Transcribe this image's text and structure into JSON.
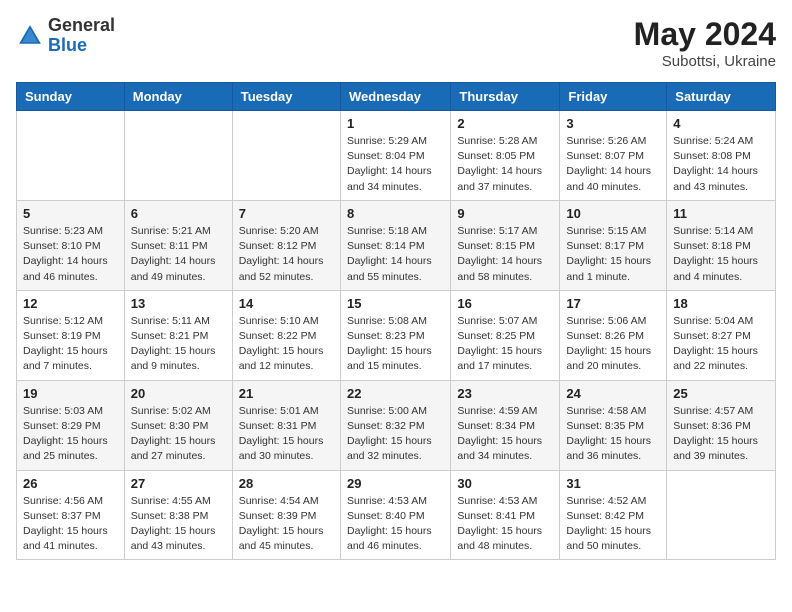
{
  "header": {
    "logo_general": "General",
    "logo_blue": "Blue",
    "month": "May 2024",
    "location": "Subottsi, Ukraine"
  },
  "weekdays": [
    "Sunday",
    "Monday",
    "Tuesday",
    "Wednesday",
    "Thursday",
    "Friday",
    "Saturday"
  ],
  "weeks": [
    [
      {
        "day": "",
        "info": ""
      },
      {
        "day": "",
        "info": ""
      },
      {
        "day": "",
        "info": ""
      },
      {
        "day": "1",
        "info": "Sunrise: 5:29 AM\nSunset: 8:04 PM\nDaylight: 14 hours\nand 34 minutes."
      },
      {
        "day": "2",
        "info": "Sunrise: 5:28 AM\nSunset: 8:05 PM\nDaylight: 14 hours\nand 37 minutes."
      },
      {
        "day": "3",
        "info": "Sunrise: 5:26 AM\nSunset: 8:07 PM\nDaylight: 14 hours\nand 40 minutes."
      },
      {
        "day": "4",
        "info": "Sunrise: 5:24 AM\nSunset: 8:08 PM\nDaylight: 14 hours\nand 43 minutes."
      }
    ],
    [
      {
        "day": "5",
        "info": "Sunrise: 5:23 AM\nSunset: 8:10 PM\nDaylight: 14 hours\nand 46 minutes."
      },
      {
        "day": "6",
        "info": "Sunrise: 5:21 AM\nSunset: 8:11 PM\nDaylight: 14 hours\nand 49 minutes."
      },
      {
        "day": "7",
        "info": "Sunrise: 5:20 AM\nSunset: 8:12 PM\nDaylight: 14 hours\nand 52 minutes."
      },
      {
        "day": "8",
        "info": "Sunrise: 5:18 AM\nSunset: 8:14 PM\nDaylight: 14 hours\nand 55 minutes."
      },
      {
        "day": "9",
        "info": "Sunrise: 5:17 AM\nSunset: 8:15 PM\nDaylight: 14 hours\nand 58 minutes."
      },
      {
        "day": "10",
        "info": "Sunrise: 5:15 AM\nSunset: 8:17 PM\nDaylight: 15 hours\nand 1 minute."
      },
      {
        "day": "11",
        "info": "Sunrise: 5:14 AM\nSunset: 8:18 PM\nDaylight: 15 hours\nand 4 minutes."
      }
    ],
    [
      {
        "day": "12",
        "info": "Sunrise: 5:12 AM\nSunset: 8:19 PM\nDaylight: 15 hours\nand 7 minutes."
      },
      {
        "day": "13",
        "info": "Sunrise: 5:11 AM\nSunset: 8:21 PM\nDaylight: 15 hours\nand 9 minutes."
      },
      {
        "day": "14",
        "info": "Sunrise: 5:10 AM\nSunset: 8:22 PM\nDaylight: 15 hours\nand 12 minutes."
      },
      {
        "day": "15",
        "info": "Sunrise: 5:08 AM\nSunset: 8:23 PM\nDaylight: 15 hours\nand 15 minutes."
      },
      {
        "day": "16",
        "info": "Sunrise: 5:07 AM\nSunset: 8:25 PM\nDaylight: 15 hours\nand 17 minutes."
      },
      {
        "day": "17",
        "info": "Sunrise: 5:06 AM\nSunset: 8:26 PM\nDaylight: 15 hours\nand 20 minutes."
      },
      {
        "day": "18",
        "info": "Sunrise: 5:04 AM\nSunset: 8:27 PM\nDaylight: 15 hours\nand 22 minutes."
      }
    ],
    [
      {
        "day": "19",
        "info": "Sunrise: 5:03 AM\nSunset: 8:29 PM\nDaylight: 15 hours\nand 25 minutes."
      },
      {
        "day": "20",
        "info": "Sunrise: 5:02 AM\nSunset: 8:30 PM\nDaylight: 15 hours\nand 27 minutes."
      },
      {
        "day": "21",
        "info": "Sunrise: 5:01 AM\nSunset: 8:31 PM\nDaylight: 15 hours\nand 30 minutes."
      },
      {
        "day": "22",
        "info": "Sunrise: 5:00 AM\nSunset: 8:32 PM\nDaylight: 15 hours\nand 32 minutes."
      },
      {
        "day": "23",
        "info": "Sunrise: 4:59 AM\nSunset: 8:34 PM\nDaylight: 15 hours\nand 34 minutes."
      },
      {
        "day": "24",
        "info": "Sunrise: 4:58 AM\nSunset: 8:35 PM\nDaylight: 15 hours\nand 36 minutes."
      },
      {
        "day": "25",
        "info": "Sunrise: 4:57 AM\nSunset: 8:36 PM\nDaylight: 15 hours\nand 39 minutes."
      }
    ],
    [
      {
        "day": "26",
        "info": "Sunrise: 4:56 AM\nSunset: 8:37 PM\nDaylight: 15 hours\nand 41 minutes."
      },
      {
        "day": "27",
        "info": "Sunrise: 4:55 AM\nSunset: 8:38 PM\nDaylight: 15 hours\nand 43 minutes."
      },
      {
        "day": "28",
        "info": "Sunrise: 4:54 AM\nSunset: 8:39 PM\nDaylight: 15 hours\nand 45 minutes."
      },
      {
        "day": "29",
        "info": "Sunrise: 4:53 AM\nSunset: 8:40 PM\nDaylight: 15 hours\nand 46 minutes."
      },
      {
        "day": "30",
        "info": "Sunrise: 4:53 AM\nSunset: 8:41 PM\nDaylight: 15 hours\nand 48 minutes."
      },
      {
        "day": "31",
        "info": "Sunrise: 4:52 AM\nSunset: 8:42 PM\nDaylight: 15 hours\nand 50 minutes."
      },
      {
        "day": "",
        "info": ""
      }
    ]
  ]
}
